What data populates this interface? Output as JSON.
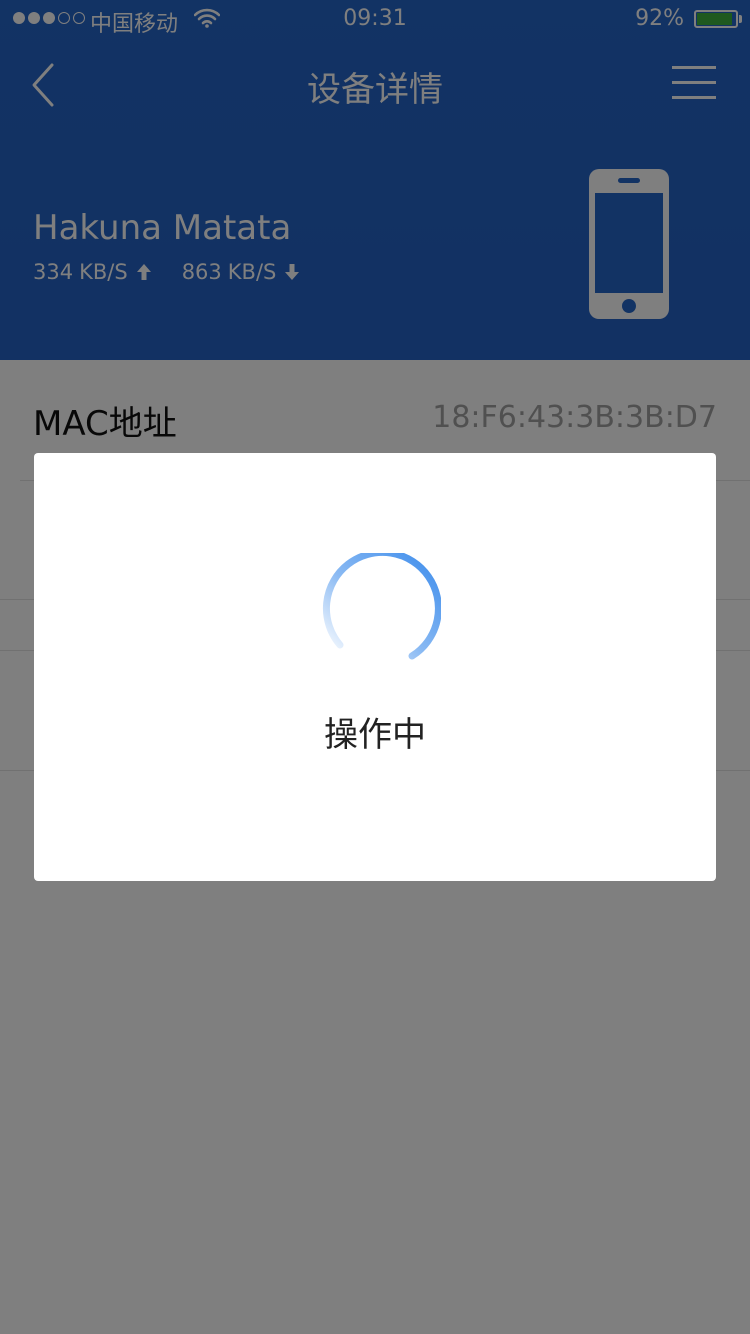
{
  "status_bar": {
    "carrier": "中国移动",
    "time": "09:31",
    "battery": "92%",
    "battery_level": 0.92
  },
  "nav": {
    "title": "设备详情"
  },
  "device": {
    "name": "Hakuna Matata",
    "upload_speed": "334",
    "upload_unit": "KB/S",
    "download_speed": "863",
    "download_unit": "KB/S"
  },
  "details": {
    "mac_label": "MAC地址",
    "mac_value": "18:F6:43:3B:3B:D7"
  },
  "dialog": {
    "message": "操作中"
  },
  "colors": {
    "header_blue": "#2566c8",
    "battery_green": "#3fb33f",
    "spinner_blue": "#3b8beb"
  }
}
